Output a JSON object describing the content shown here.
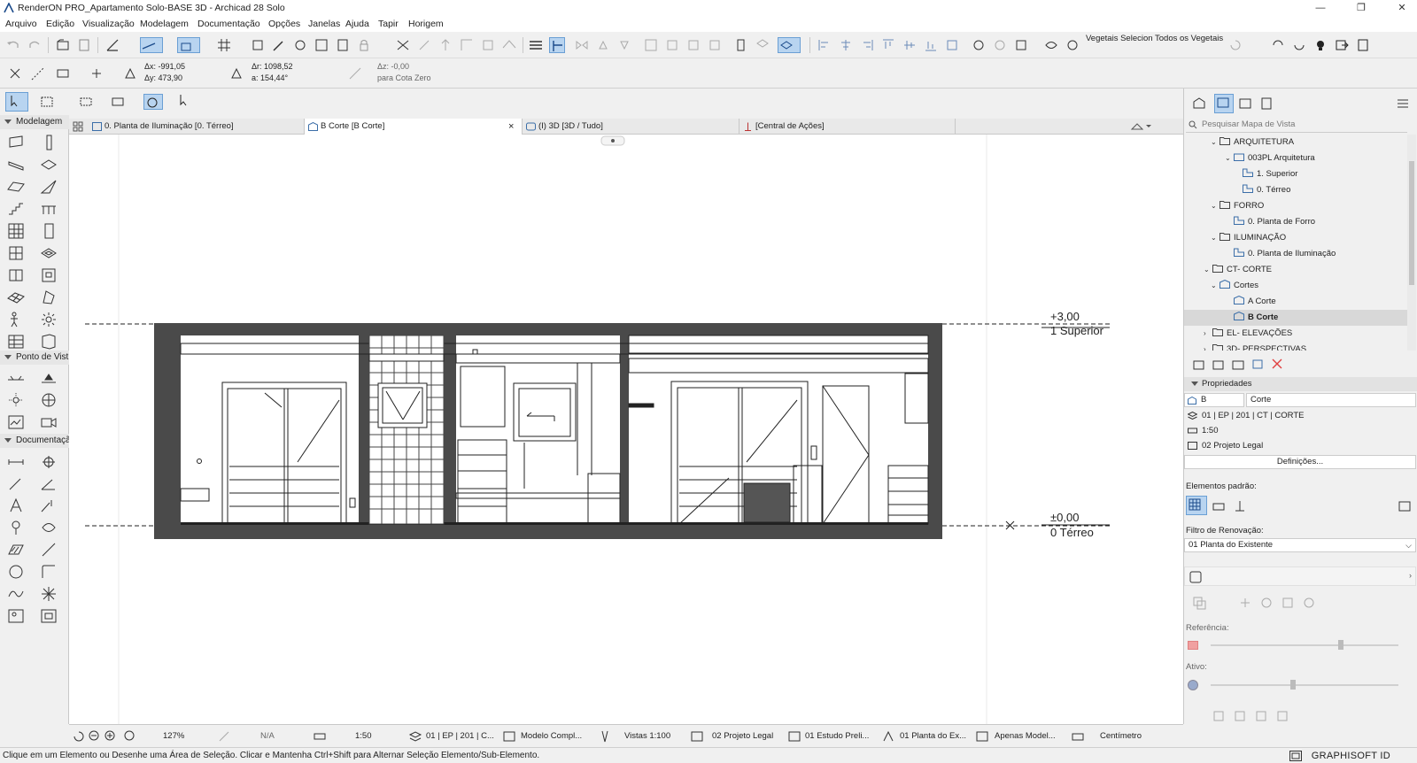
{
  "window": {
    "title": "RenderON PRO_Apartamento Solo-BASE 3D - Archicad 28 Solo",
    "minimize": "—",
    "maximize": "❐",
    "close": "✕"
  },
  "menu": [
    "Arquivo",
    "Edição",
    "Visualização",
    "Modelagem",
    "Documentação",
    "Opções",
    "Janelas",
    "Ajuda",
    "Tapir",
    "Horigem"
  ],
  "toolbar": {
    "vegetais_selecionados": "Vegetais Selecion",
    "todos_vegetais": "Todos os Vegetais"
  },
  "coords": {
    "dx": "Δx: -991,05",
    "dy": "Δy: 473,90",
    "dr": "Δr: 1098,52",
    "a": "a: 154,44°",
    "dz": "Δz: -0,00",
    "cota": "para Cota Zero"
  },
  "toolbox": {
    "groups": [
      "Modelagem",
      "Ponto de Vist",
      "Documentaçã"
    ]
  },
  "tabs": [
    {
      "label": "0. Planta de Iluminação [0. Térreo]"
    },
    {
      "label": "B Corte [B Corte]",
      "active": true
    },
    {
      "label": "(I) 3D [3D / Tudo]"
    },
    {
      "label": "[Central de Ações]"
    }
  ],
  "tab_close": "×",
  "drawing": {
    "level_top_value": "+3,00",
    "level_top_name": "1 Superior",
    "level_bottom_value": "±0,00",
    "level_bottom_name": "0 Térreo"
  },
  "navigator": {
    "search_placeholder": "Pesquisar Mapa de Vista",
    "tree": [
      {
        "label": "ARQUITETURA",
        "level": 0,
        "type": "folder"
      },
      {
        "label": "003PL Arquitetura",
        "level": 1,
        "type": "plan-folder"
      },
      {
        "label": "1. Superior",
        "level": 2,
        "type": "plan"
      },
      {
        "label": "0. Térreo",
        "level": 2,
        "type": "plan"
      },
      {
        "label": "FORRO",
        "level": 0,
        "type": "folder"
      },
      {
        "label": "0. Planta de Forro",
        "level": 1,
        "type": "plan"
      },
      {
        "label": "ILUMINAÇÃO",
        "level": 0,
        "type": "folder"
      },
      {
        "label": "0. Planta de Iluminação",
        "level": 1,
        "type": "plan"
      },
      {
        "label": "CT- CORTE",
        "level": -1,
        "type": "folder"
      },
      {
        "label": "Cortes",
        "level": 0,
        "type": "section-folder"
      },
      {
        "label": "A Corte",
        "level": 1,
        "type": "section"
      },
      {
        "label": "B Corte",
        "level": 1,
        "type": "section",
        "selected": true
      },
      {
        "label": "EL- ELEVAÇÕES",
        "level": -1,
        "type": "folder"
      },
      {
        "label": "3D- PERSPECTIVAS",
        "level": -1,
        "type": "folder"
      }
    ]
  },
  "properties": {
    "header": "Propriedades",
    "id": "B",
    "name": "Corte",
    "layer": "01 | EP | 201 | CT | CORTE",
    "scale": "1:50",
    "penset": "02 Projeto Legal",
    "definitions_button": "Definições...",
    "default_elements_label": "Elementos padrão:",
    "renovation_filter_label": "Filtro de Renovação:",
    "renovation_filter_value": "01 Planta do Existente",
    "reference_label": "Referência:",
    "active_label": "Ativo:"
  },
  "statusbar": {
    "zoom": "127%",
    "na": "N/A",
    "scale": "1:50",
    "layer_combo": "01 | EP | 201 | C...",
    "model": "Modelo Compl...",
    "views": "Vistas 1:100",
    "pen": "02 Projeto Legal",
    "study": "01 Estudo Preli...",
    "plan": "01 Planta do Ex...",
    "only_model": "Apenas Model...",
    "unit": "Centímetro"
  },
  "hint": "Clique em um Elemento ou Desenhe uma Área de Seleção. Clicar e Mantenha Ctrl+Shift para Alternar Seleção Elemento/Sub-Elemento.",
  "brand": "GRAPHISOFT ID"
}
